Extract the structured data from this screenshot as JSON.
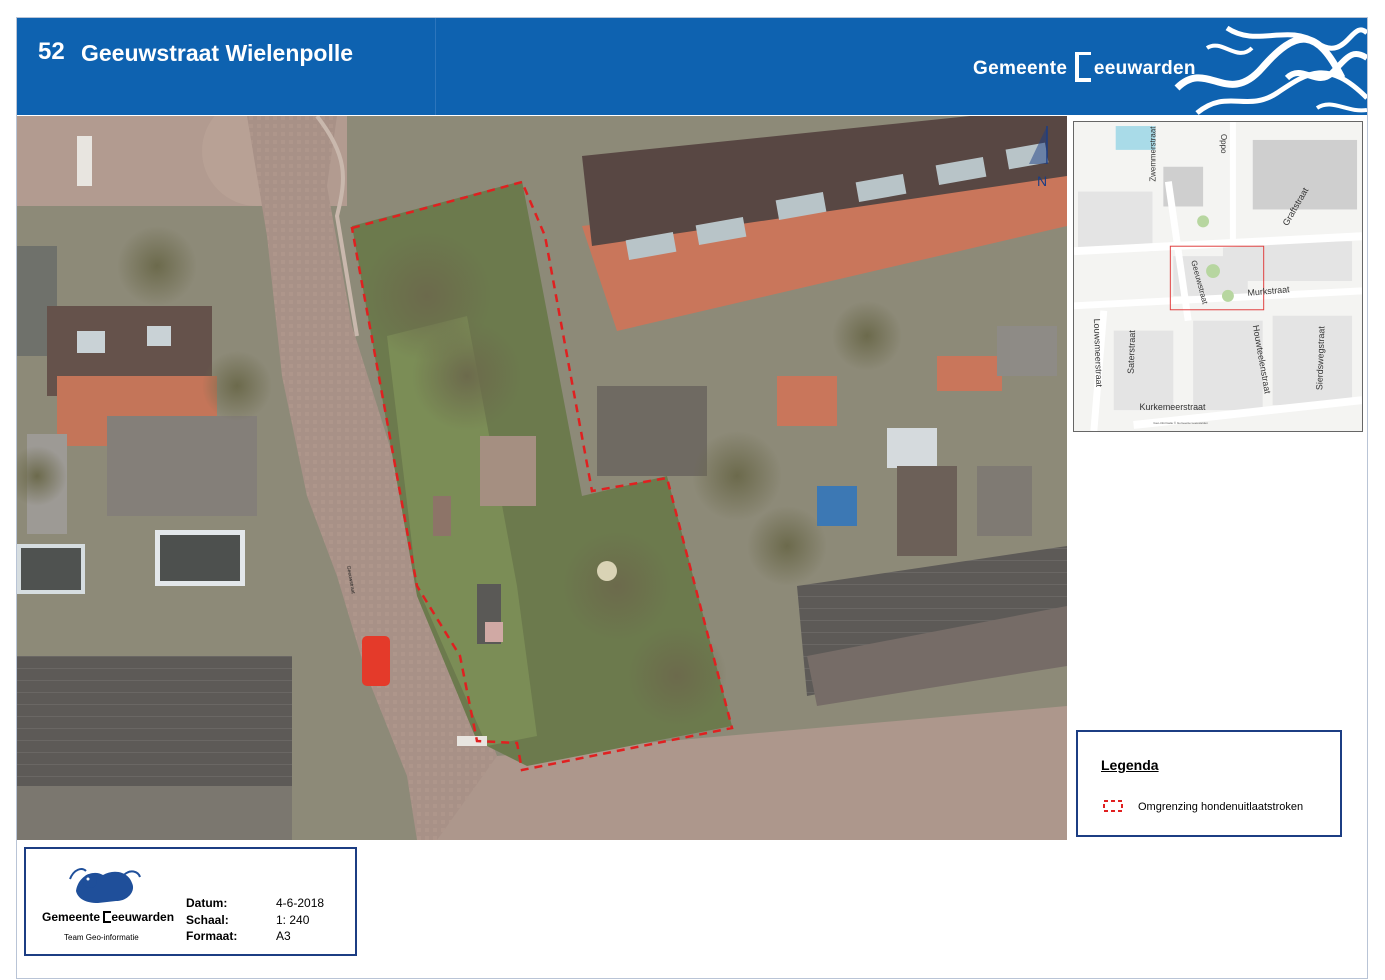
{
  "header": {
    "map_number": "52",
    "map_title": "Geeuwstraat Wielenpolle",
    "brand_prefix": "Gemeente ",
    "brand_rest": "eeuwarden"
  },
  "aerial": {
    "street_label": "Geeuwstraat",
    "north_label": "N",
    "boundary_color": "#e02020"
  },
  "inset": {
    "streets": [
      "Oppo",
      "Zwemmerstraat",
      "Graftstraat",
      "Geeuwstraat",
      "Murkstraat",
      "Louwsmeerstraat",
      "Saterstraat",
      "Houwteelenstraat",
      "Sierdswegstraat",
      "Kurkemeerstraat"
    ],
    "footer": "Geo-informatie © Gemeente Leeuwarden",
    "highlight_color": "#e04040"
  },
  "legend": {
    "title": "Legenda",
    "items": [
      {
        "label": "Omgrenzing hondenuitlaatstroken",
        "color": "#e02020"
      }
    ]
  },
  "info": {
    "brand_prefix": "Gemeente ",
    "brand_rest": "eeuwarden",
    "team": "Team Geo-informatie",
    "rows": [
      {
        "label": "Datum:",
        "value": "4-6-2018"
      },
      {
        "label": "Schaal:",
        "value": "1: 240"
      },
      {
        "label": "Formaat:",
        "value": "A3"
      }
    ]
  },
  "colors": {
    "header_blue": "#0e62b0",
    "box_border": "#1c3d83"
  }
}
